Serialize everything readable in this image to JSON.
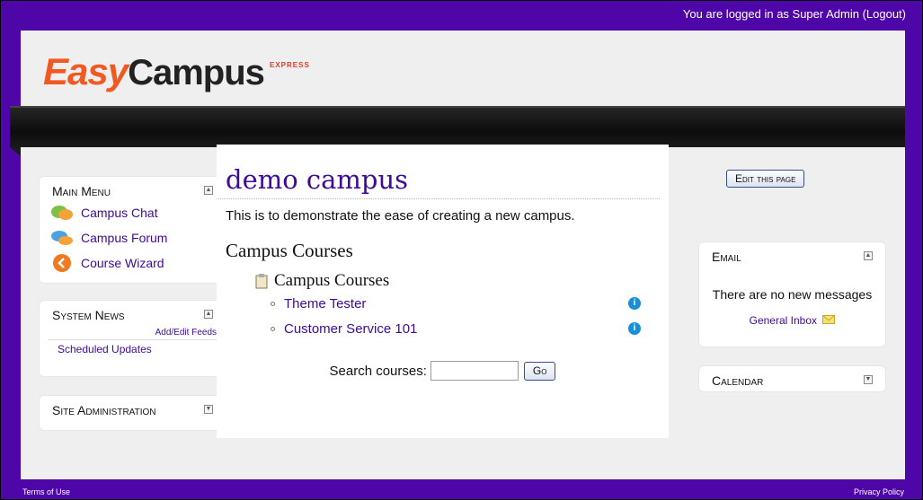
{
  "topbar": {
    "login_text": "You are logged in as Super Admin (Logout)"
  },
  "logo": {
    "easy": "Easy",
    "campus": "Campus",
    "express": "EXPRESS"
  },
  "main_menu": {
    "title": "Main Menu",
    "items": [
      {
        "label": "Campus Chat",
        "icon": "chat-icon"
      },
      {
        "label": "Campus Forum",
        "icon": "forum-icon"
      },
      {
        "label": "Course Wizard",
        "icon": "wizard-icon"
      }
    ]
  },
  "system_news": {
    "title": "System News",
    "edit_link": "Add/Edit Feeds",
    "items": [
      "Scheduled Updates"
    ]
  },
  "site_admin": {
    "title": "Site Administration"
  },
  "main": {
    "title": "demo campus",
    "description": "This is to demonstrate the ease of creating a new campus.",
    "section_title": "Campus Courses",
    "category": "Campus Courses",
    "courses": [
      "Theme Tester",
      "Customer Service 101"
    ],
    "search_label": "Search courses:",
    "search_value": "",
    "go_label": "Go"
  },
  "edit_page_label": "Edit this page",
  "email": {
    "title": "Email",
    "message": "There are no new messages",
    "inbox_link": "General Inbox"
  },
  "calendar": {
    "title": "Calendar"
  },
  "footer": {
    "terms": "Terms of Use",
    "privacy": "Privacy Policy"
  },
  "colors": {
    "frame": "#4e06a8",
    "link": "#3d0a99",
    "accent": "#f05a22"
  }
}
